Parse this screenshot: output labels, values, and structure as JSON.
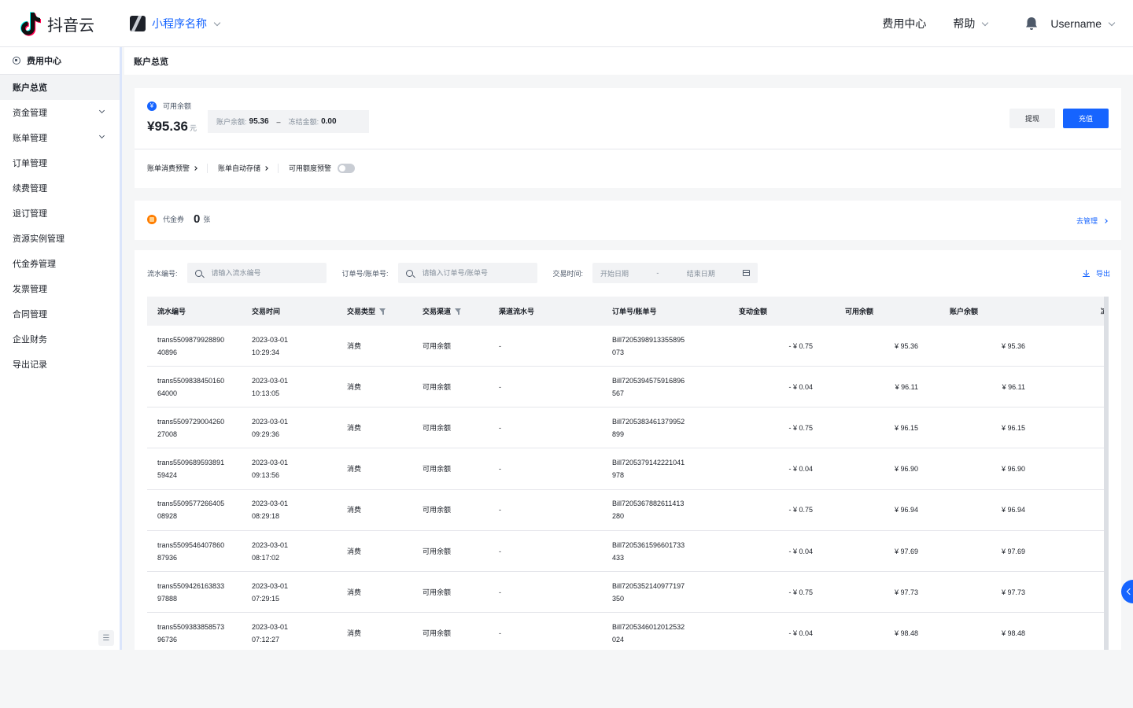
{
  "topbar": {
    "logo_text": "抖音云",
    "app_name": "小程序名称",
    "nav_billing": "费用中心",
    "nav_help": "帮助",
    "username": "Username"
  },
  "sidebar": {
    "section_title": "费用中心",
    "items": [
      {
        "label": "账户总览",
        "active": true,
        "expandable": false
      },
      {
        "label": "资金管理",
        "active": false,
        "expandable": true
      },
      {
        "label": "账单管理",
        "active": false,
        "expandable": true
      },
      {
        "label": "订单管理",
        "active": false,
        "expandable": false
      },
      {
        "label": "续费管理",
        "active": false,
        "expandable": false
      },
      {
        "label": "退订管理",
        "active": false,
        "expandable": false
      },
      {
        "label": "资源实例管理",
        "active": false,
        "expandable": false
      },
      {
        "label": "代金券管理",
        "active": false,
        "expandable": false
      },
      {
        "label": "发票管理",
        "active": false,
        "expandable": false
      },
      {
        "label": "合同管理",
        "active": false,
        "expandable": false
      },
      {
        "label": "企业财务",
        "active": false,
        "expandable": false
      },
      {
        "label": "导出记录",
        "active": false,
        "expandable": false
      }
    ]
  },
  "breadcrumb": "账户总览",
  "balance": {
    "label": "可用余额",
    "value": "¥95.36",
    "unit": "元",
    "account_label": "账户余额:",
    "account_value": "95.36",
    "separator": "–",
    "frozen_label": "冻结金额:",
    "frozen_value": "0.00",
    "withdraw_label": "提现",
    "recharge_label": "充值"
  },
  "alerts": {
    "consume_alert": "账单消费预警",
    "auto_store": "账单自动存储",
    "credit_alert": "可用额度预警"
  },
  "voucher": {
    "label": "代金券",
    "count": "0",
    "unit": "张",
    "manage_link": "去管理"
  },
  "filters": {
    "serial_label": "流水编号:",
    "serial_placeholder": "请输入流水编号",
    "order_label": "订单号/账单号:",
    "order_placeholder": "请输入订单号/账单号",
    "time_label": "交易时间:",
    "start_placeholder": "开始日期",
    "range_sep": "-",
    "end_placeholder": "结束日期",
    "export_label": "导出"
  },
  "table": {
    "columns": [
      "流水编号",
      "交易时间",
      "交易类型",
      "交易渠道",
      "渠道流水号",
      "订单号/账单号",
      "变动金额",
      "可用余额",
      "账户余额",
      "冻"
    ],
    "rows": [
      {
        "serial": "trans5509879928890\n40896",
        "time": "2023-03-01\n10:29:34",
        "type": "消费",
        "channel": "可用余额",
        "channel_serial": "-",
        "order": "Bill7205398913355895\n073",
        "change": "- ¥ 0.75",
        "available": "¥ 95.36",
        "account": "¥ 95.36"
      },
      {
        "serial": "trans5509838450160\n64000",
        "time": "2023-03-01\n10:13:05",
        "type": "消费",
        "channel": "可用余额",
        "channel_serial": "-",
        "order": "Bill7205394575916896\n567",
        "change": "- ¥ 0.04",
        "available": "¥ 96.11",
        "account": "¥ 96.11"
      },
      {
        "serial": "trans5509729004260\n27008",
        "time": "2023-03-01\n09:29:36",
        "type": "消费",
        "channel": "可用余额",
        "channel_serial": "-",
        "order": "Bill7205383461379952\n899",
        "change": "- ¥ 0.75",
        "available": "¥ 96.15",
        "account": "¥ 96.15"
      },
      {
        "serial": "trans5509689593891\n59424",
        "time": "2023-03-01\n09:13:56",
        "type": "消费",
        "channel": "可用余额",
        "channel_serial": "-",
        "order": "Bill7205379142221041\n978",
        "change": "- ¥ 0.04",
        "available": "¥ 96.90",
        "account": "¥ 96.90"
      },
      {
        "serial": "trans5509577266405\n08928",
        "time": "2023-03-01\n08:29:18",
        "type": "消费",
        "channel": "可用余额",
        "channel_serial": "-",
        "order": "Bill7205367882611413\n280",
        "change": "- ¥ 0.75",
        "available": "¥ 96.94",
        "account": "¥ 96.94"
      },
      {
        "serial": "trans5509546407860\n87936",
        "time": "2023-03-01\n08:17:02",
        "type": "消费",
        "channel": "可用余额",
        "channel_serial": "-",
        "order": "Bill7205361596601733\n433",
        "change": "- ¥ 0.04",
        "available": "¥ 97.69",
        "account": "¥ 97.69"
      },
      {
        "serial": "trans5509426163833\n97888",
        "time": "2023-03-01\n07:29:15",
        "type": "消费",
        "channel": "可用余额",
        "channel_serial": "-",
        "order": "Bill7205352140977197\n350",
        "change": "- ¥ 0.75",
        "available": "¥ 97.73",
        "account": "¥ 97.73"
      },
      {
        "serial": "trans5509383858573\n96736",
        "time": "2023-03-01\n07:12:27",
        "type": "消费",
        "channel": "可用余额",
        "channel_serial": "-",
        "order": "Bill7205346012012532\n024",
        "change": "- ¥ 0.04",
        "available": "¥ 98.48",
        "account": "¥ 98.48"
      }
    ]
  },
  "colors": {
    "accent": "#1664ff",
    "voucher": "#ff7d00"
  }
}
